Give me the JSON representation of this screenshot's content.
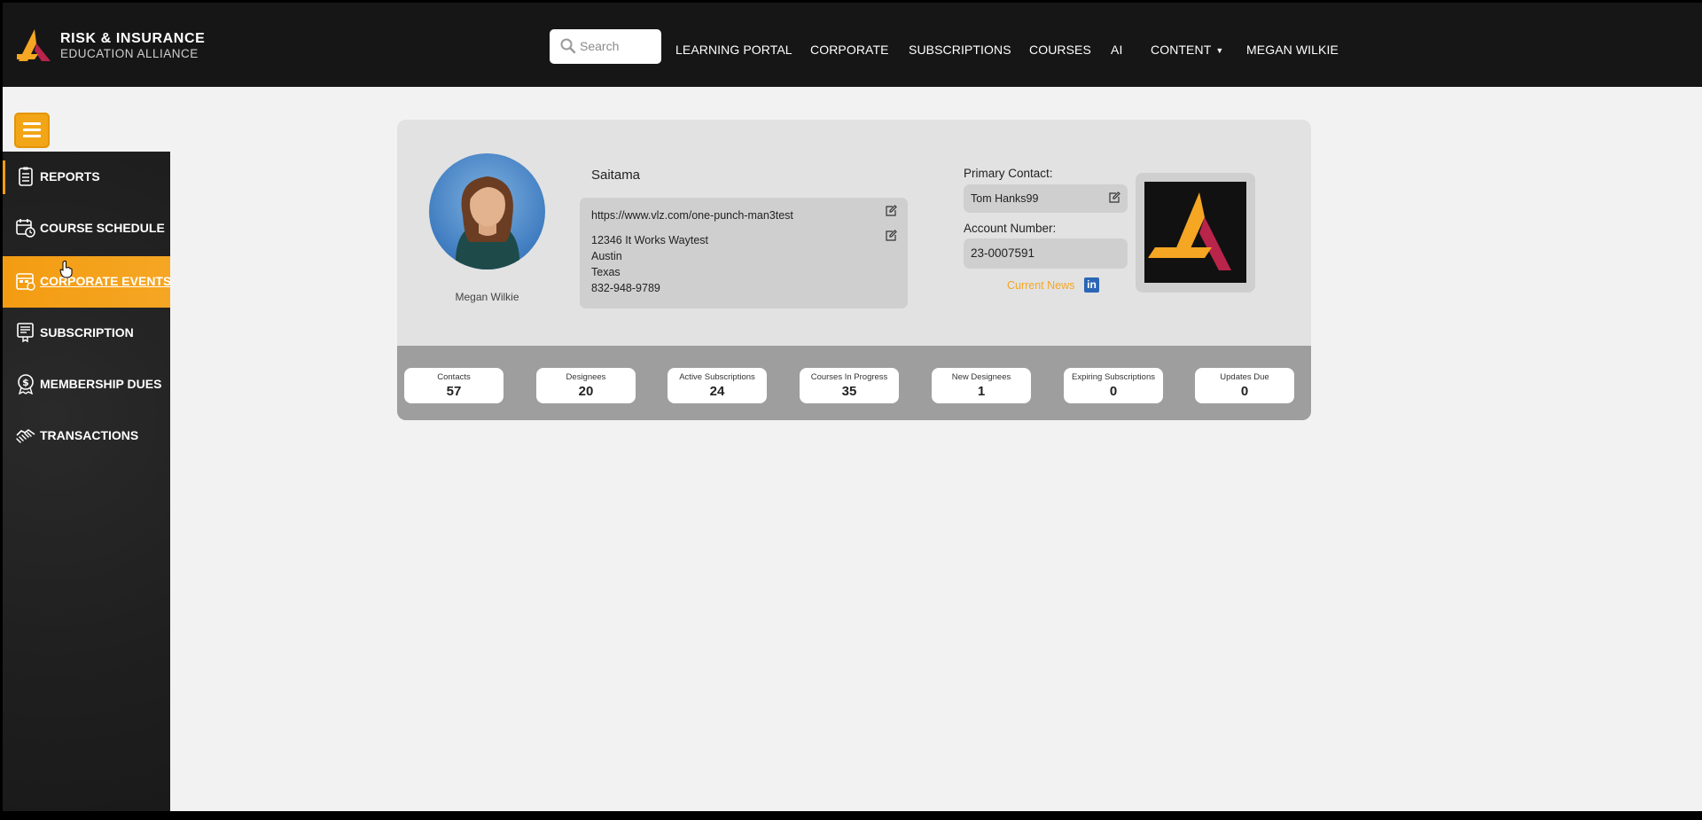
{
  "brand": {
    "line1": "RISK & INSURANCE",
    "line2": "EDUCATION ALLIANCE"
  },
  "search": {
    "placeholder": "Search"
  },
  "nav": {
    "items": [
      "LEARNING PORTAL",
      "CORPORATE",
      "SUBSCRIPTIONS",
      "COURSES",
      "AI",
      "CONTENT",
      "MEGAN WILKIE"
    ]
  },
  "sidebar": {
    "items": [
      {
        "label": "REPORTS",
        "icon": "clipboard-list-icon"
      },
      {
        "label": "COURSE SCHEDULE",
        "icon": "calendar-clock-icon"
      },
      {
        "label": "CORPORATE EVENTS",
        "icon": "calendar-event-icon",
        "active": true
      },
      {
        "label": "SUBSCRIPTION",
        "icon": "certificate-icon"
      },
      {
        "label": "MEMBERSHIP DUES",
        "icon": "badge-dollar-icon"
      },
      {
        "label": "TRANSACTIONS",
        "icon": "handshake-icon"
      }
    ]
  },
  "profile": {
    "name": "Megan Wilkie",
    "company": "Saitama",
    "url": "https://www.vlz.com/one-punch-man3test",
    "address": {
      "street": "12346 It Works Waytest",
      "city": "Austin",
      "state": "Texas",
      "phone": "832-948-9789"
    },
    "primary_contact_label": "Primary Contact:",
    "primary_contact": "Tom Hanks99",
    "account_number_label": "Account Number:",
    "account_number": "23-0007591",
    "current_news": "Current News",
    "linkedin": "in"
  },
  "stats": [
    {
      "title": "Contacts",
      "value": "57"
    },
    {
      "title": "Designees",
      "value": "20"
    },
    {
      "title": "Active Subscriptions",
      "value": "24"
    },
    {
      "title": "Courses In Progress",
      "value": "35"
    },
    {
      "title": "New Designees",
      "value": "1"
    },
    {
      "title": "Expiring Subscriptions",
      "value": "0"
    },
    {
      "title": "Updates Due",
      "value": "0"
    }
  ],
  "colors": {
    "accent": "#f39c12",
    "header": "#161616",
    "sidebar": "#222222",
    "logo_red": "#b8244a",
    "linkedin": "#2a66b5"
  }
}
